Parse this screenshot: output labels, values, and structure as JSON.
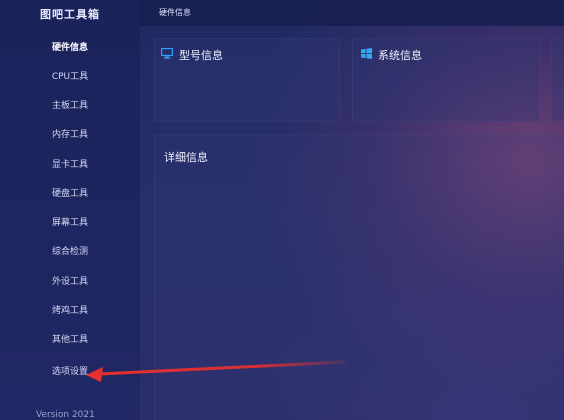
{
  "app": {
    "title": "图吧工具箱"
  },
  "sidebar": {
    "items": [
      {
        "label": "硬件信息",
        "active": true
      },
      {
        "label": "CPU工具",
        "active": false
      },
      {
        "label": "主板工具",
        "active": false
      },
      {
        "label": "内存工具",
        "active": false
      },
      {
        "label": "显卡工具",
        "active": false
      },
      {
        "label": "硬盘工具",
        "active": false
      },
      {
        "label": "屏幕工具",
        "active": false
      },
      {
        "label": "综合检测",
        "active": false
      },
      {
        "label": "外设工具",
        "active": false
      },
      {
        "label": "烤鸡工具",
        "active": false
      },
      {
        "label": "其他工具",
        "active": false
      },
      {
        "label": "选项设置",
        "active": false
      }
    ],
    "footer": "Version 2021"
  },
  "header": {
    "title": "硬件信息"
  },
  "panels": {
    "model": {
      "title": "型号信息",
      "icon": "monitor-icon"
    },
    "system": {
      "title": "系统信息",
      "icon": "windows-icon"
    },
    "detail": {
      "title": "详细信息"
    }
  },
  "colors": {
    "arrow": "#e8302f",
    "monitor_icon": "#3aa0ff",
    "windows_icon": "#33a8f0"
  }
}
